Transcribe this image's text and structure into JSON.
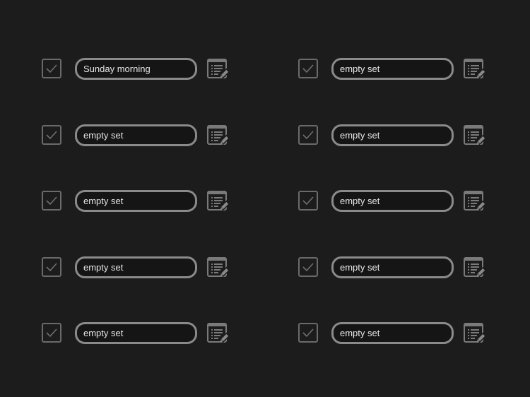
{
  "columns": [
    {
      "rows": [
        {
          "value": "Sunday morning",
          "checked": true
        },
        {
          "value": "empty set",
          "checked": true
        },
        {
          "value": "empty set",
          "checked": true
        },
        {
          "value": "empty set",
          "checked": true
        },
        {
          "value": "empty set",
          "checked": true
        }
      ]
    },
    {
      "rows": [
        {
          "value": "empty set",
          "checked": true
        },
        {
          "value": "empty set",
          "checked": true
        },
        {
          "value": "empty set",
          "checked": true
        },
        {
          "value": "empty set",
          "checked": true
        },
        {
          "value": "empty set",
          "checked": true
        }
      ]
    }
  ],
  "icons": {
    "checkbox": "check-icon",
    "edit": "notes-edit-icon"
  },
  "colors": {
    "background": "#1c1c1d",
    "field_border": "#8a8a8a",
    "checkbox_border": "#6a6a6a",
    "text": "#e6e6e6"
  }
}
